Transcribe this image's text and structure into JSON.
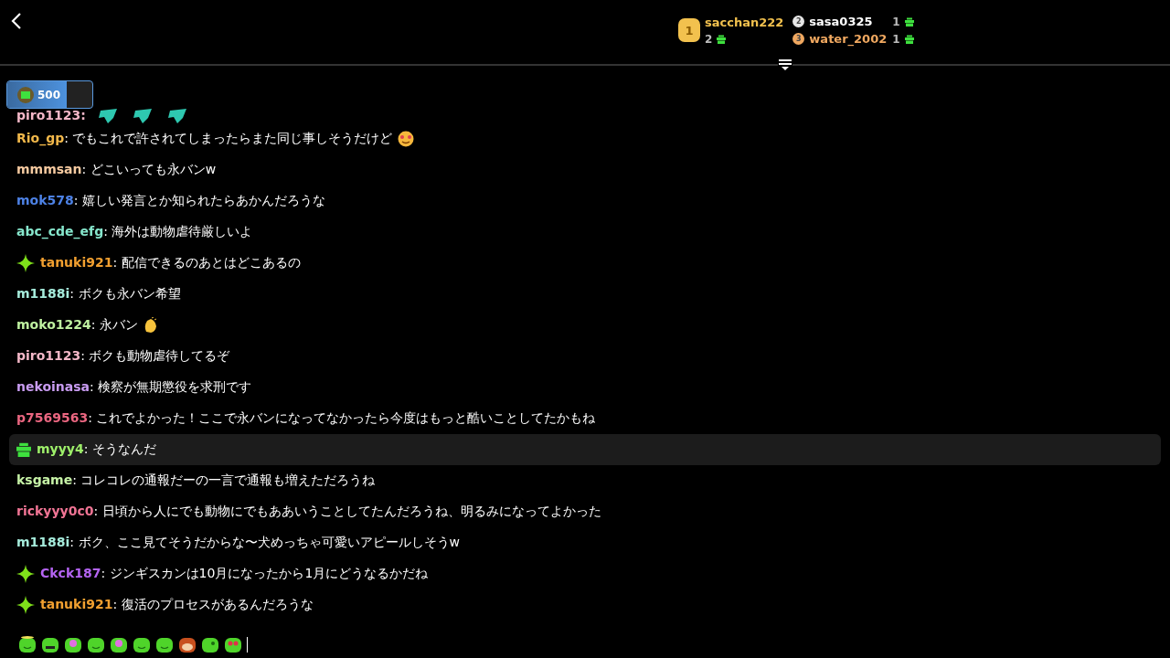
{
  "leaderboard": [
    {
      "rank": "1",
      "name": "sacchan222",
      "count": "2",
      "color": "#f2c14e"
    },
    {
      "rank": "2",
      "name": "sasa0325",
      "count": "1",
      "color": "#e6e6e6"
    },
    {
      "rank": "3",
      "name": "water_2002",
      "count": "1",
      "color": "#f0a860"
    }
  ],
  "points": {
    "value": "500",
    "level": 0.7
  },
  "chat": [
    {
      "kind": "clipped",
      "user": "piro1123:",
      "color": "#f4b8c8",
      "emote": {
        "kind": "gems"
      },
      "highlighted": false
    },
    {
      "kind": "message",
      "user": "Rio_gp",
      "text": ": でもこれで許されてしまったらまた同じ事しそうだけど",
      "color": "#f2b84a",
      "emote": {
        "kind": "smile"
      },
      "highlighted": false
    },
    {
      "kind": "message",
      "user": "mmmsan",
      "text": ": どこいっても永バンw",
      "color": "#f6caa0",
      "highlighted": false
    },
    {
      "kind": "message",
      "user": "mok578",
      "text": ": 嬉しい発言とか知られたらあかんだろうな",
      "color": "#4d82e6",
      "highlighted": false
    },
    {
      "kind": "message",
      "user": "abc_cde_efg",
      "text": ": 海外は動物虐待厳しいよ",
      "color": "#86e6cc",
      "highlighted": false
    },
    {
      "kind": "message",
      "user": "tanuki921",
      "text": ": 配信できるのあとはどこあるの",
      "color": "#f2a030",
      "badge": {
        "kind": "sparkle"
      },
      "highlighted": false
    },
    {
      "kind": "message",
      "user": "m1188i",
      "text": ": ボクも永バン希望",
      "color": "#a6ecdc",
      "highlighted": false
    },
    {
      "kind": "message",
      "user": "moko1224",
      "text": ": 永バン",
      "color": "#bff2a0",
      "emote": {
        "kind": "clap"
      },
      "highlighted": false
    },
    {
      "kind": "message",
      "user": "piro1123",
      "text": ": ボクも動物虐待してるぞ",
      "color": "#f4b8c8",
      "highlighted": false
    },
    {
      "kind": "message",
      "user": "nekoinasa",
      "text": ": 検察が無期懲役を求刑です",
      "color": "#c99cf2",
      "highlighted": false
    },
    {
      "kind": "message",
      "user": "p7569563",
      "text": ": これでよかった！ここで永バンになってなかったら今度はもっと酷いことしてたかもね",
      "color": "#ea6680",
      "highlighted": false
    },
    {
      "kind": "message",
      "user": "myyy4",
      "text": ": そうなんだ",
      "color": "#9ef06a",
      "badge": {
        "kind": "gift"
      },
      "highlighted": true
    },
    {
      "kind": "message",
      "user": "ksgame",
      "text": ": コレコレの通報だーの一言で通報も増えただろうね",
      "color": "#c6f2a6",
      "highlighted": false
    },
    {
      "kind": "message",
      "user": "rickyyy0c0",
      "text": ": 日頃から人にでも動物にでもああいうことしてたんだろうね、明るみになってよかった",
      "color": "#f07494",
      "highlighted": false
    },
    {
      "kind": "message",
      "user": "m1188i",
      "text": ": ボク、ここ見てそうだからな〜犬めっちゃ可愛いアピールしそうw",
      "color": "#a6ecdc",
      "highlighted": false
    },
    {
      "kind": "message",
      "user": "Ckck187",
      "text": ": ジンギスカンは10月になったから1月にどうなるかだね",
      "color": "#b464f2",
      "badge": {
        "kind": "sparkle"
      },
      "highlighted": false
    },
    {
      "kind": "message",
      "user": "tanuki921",
      "text": ": 復活のプロセスがあるんだろうな",
      "color": "#f2a030",
      "badge": {
        "kind": "sparkle"
      },
      "highlighted": false
    }
  ],
  "input": {
    "emotes": [
      {
        "kind": "halo"
      },
      {
        "kind": "angry"
      },
      {
        "kind": "headphones"
      },
      {
        "kind": "smile"
      },
      {
        "kind": "headphones"
      },
      {
        "kind": "smile"
      },
      {
        "kind": "smile"
      },
      {
        "kind": "monkey"
      },
      {
        "kind": "wink"
      },
      {
        "kind": "hearts"
      }
    ]
  }
}
